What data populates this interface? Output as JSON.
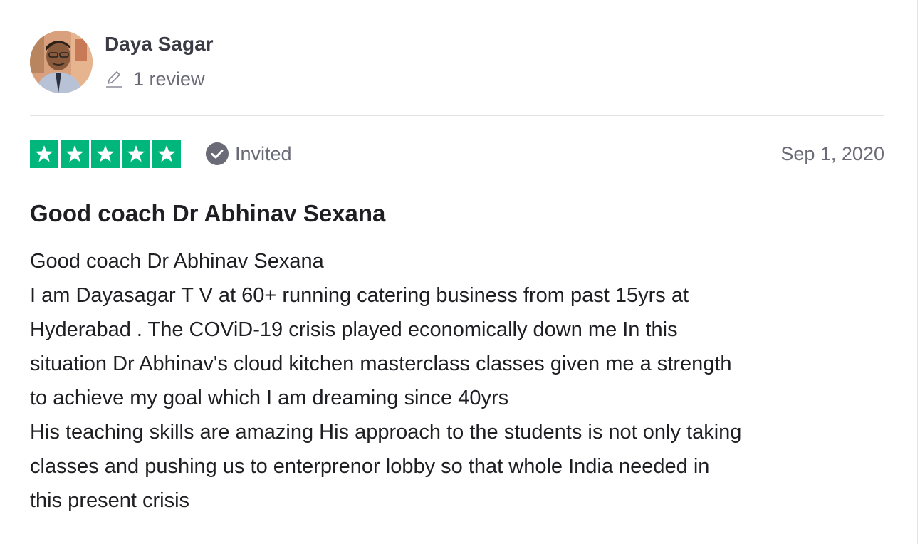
{
  "consumer": {
    "name": "Daya Sagar",
    "review_count": "1 review",
    "avatar_icon": "avatar-photo"
  },
  "review": {
    "rating": 5,
    "max_rating": 5,
    "star_color": "#00b67a",
    "verification_label": "Invited",
    "date": "Sep 1, 2020",
    "title": "Good coach Dr Abhinav Sexana",
    "body_lines": [
      "Good coach Dr Abhinav Sexana",
      "I am Dayasagar T V at 60+ running catering business from past 15yrs at",
      "Hyderabad . The COViD-19 crisis played economically down me In this",
      "situation Dr Abhinav's cloud kitchen masterclass classes given me a strength",
      "to achieve my goal which I am dreaming since 40yrs",
      "His teaching skills are amazing His approach to the students is not only taking",
      "classes and pushing us to enterprenor lobby so that whole India needed in",
      "this present crisis"
    ]
  },
  "colors": {
    "text_primary": "#1f1f23",
    "text_secondary": "#6b6b78",
    "divider": "#e2e2e6"
  }
}
